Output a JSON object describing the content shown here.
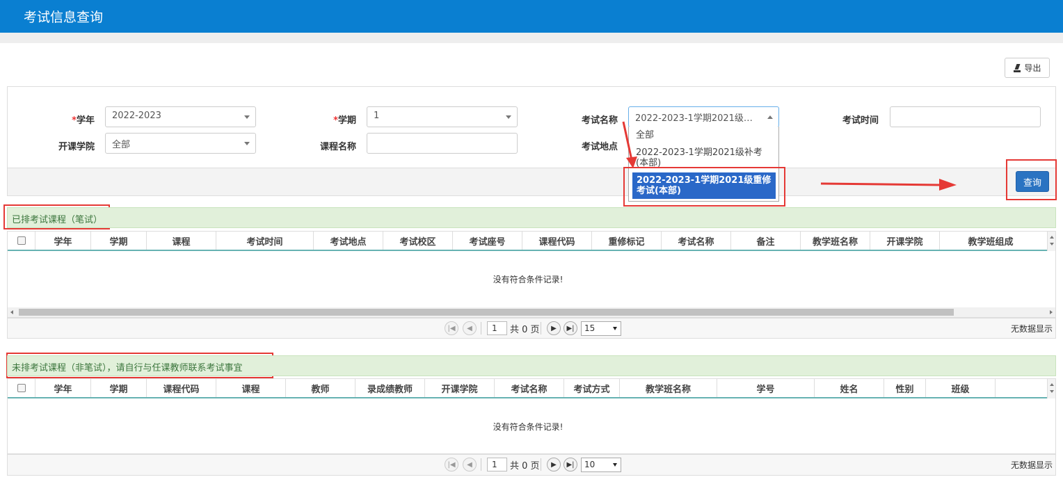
{
  "header": {
    "title": "考试信息查询"
  },
  "toolbar": {
    "export_label": "导出"
  },
  "form": {
    "year_label": "学年",
    "year_value": "2022-2023",
    "term_label": "学期",
    "term_value": "1",
    "exam_name_label": "考试名称",
    "exam_name_value": "2022-2023-1学期2021级…",
    "exam_time_label": "考试时间",
    "college_label": "开课学院",
    "college_value": "全部",
    "course_name_label": "课程名称",
    "exam_place_label": "考试地点",
    "required_mark": "*",
    "exam_name_options": [
      "全部",
      "2022-2023-1学期2021级补考(本部)",
      "2022-2023-1学期2021级重修考试(本部)"
    ],
    "query_label": "查询"
  },
  "scheduled": {
    "title": "已排考试课程（笔试）",
    "columns": [
      "学年",
      "学期",
      "课程",
      "考试时间",
      "考试地点",
      "考试校区",
      "考试座号",
      "课程代码",
      "重修标记",
      "考试名称",
      "备注",
      "教学班名称",
      "开课学院",
      "教学班组成"
    ],
    "empty_message": "没有符合条件记录!",
    "pager": {
      "page": "1",
      "total_text": "共 0 页",
      "page_size": "15",
      "no_data": "无数据显示"
    }
  },
  "unscheduled": {
    "title": "未排考试课程（非笔试），请自行与任课教师联系考试事宜",
    "columns": [
      "学年",
      "学期",
      "课程代码",
      "课程",
      "教师",
      "录成绩教师",
      "开课学院",
      "考试名称",
      "考试方式",
      "教学班名称",
      "学号",
      "姓名",
      "性别",
      "班级"
    ],
    "empty_message": "没有符合条件记录!",
    "pager": {
      "page": "1",
      "total_text": "共 0 页",
      "page_size": "10",
      "no_data": "无数据显示"
    }
  },
  "colors": {
    "header_bg": "#0a7fd1",
    "section_bg": "#e1f0da",
    "highlight": "#e53935",
    "selected_option": "#2a68c8"
  }
}
